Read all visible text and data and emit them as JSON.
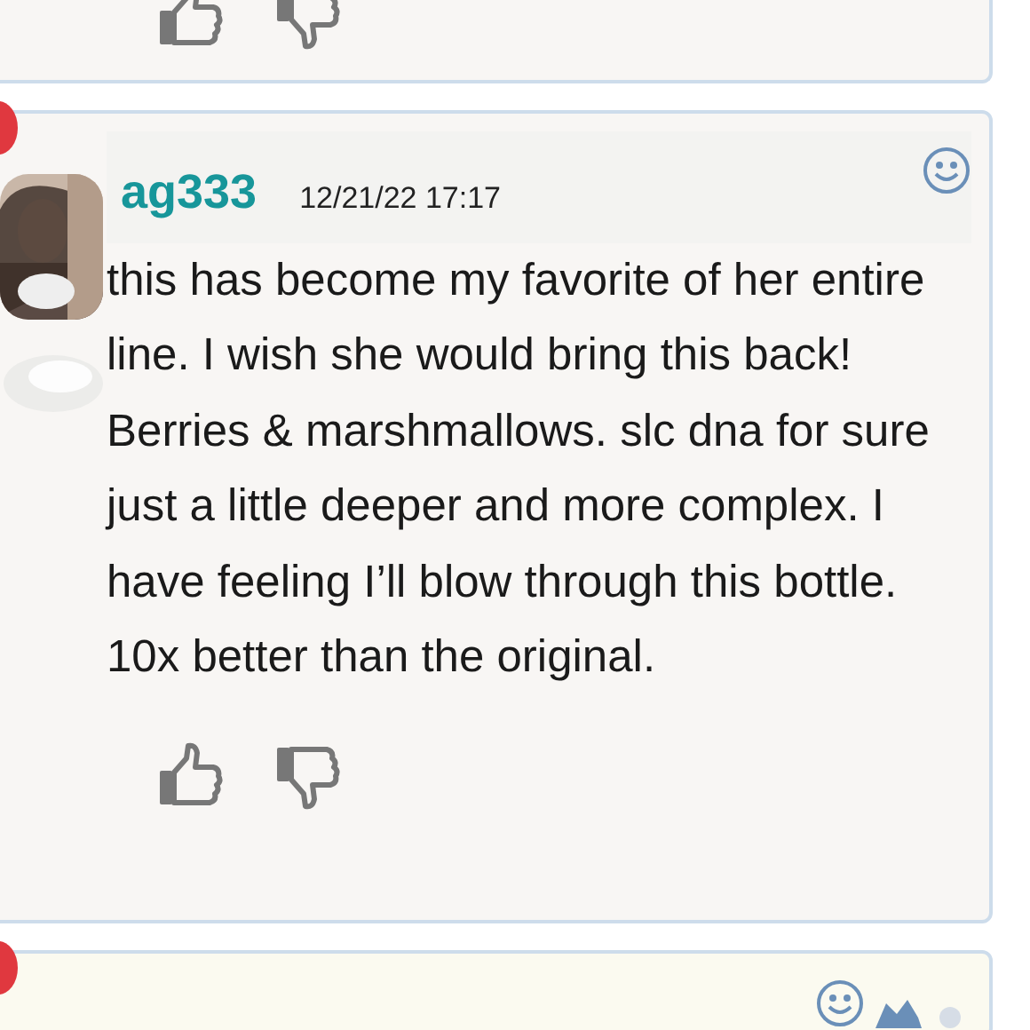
{
  "reviews": [
    {
      "kind": "tail"
    },
    {
      "kind": "full",
      "username": "ag333",
      "date": "12/21/22 17:17",
      "text": "this has become my favorite of her entire line. I wish she would bring this back! Berries & marshmallows. slc dna for sure just a little deeper and more complex. I have feeling I’ll blow through this bottle. 10x better than the original."
    },
    {
      "kind": "head"
    }
  ]
}
